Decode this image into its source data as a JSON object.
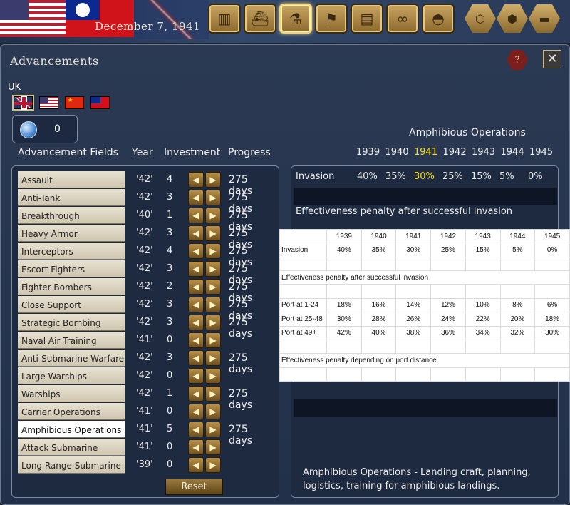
{
  "topbar": {
    "date": "December 7, 1941",
    "icons": [
      "factory-icon",
      "ship-icon",
      "microscope-icon",
      "flag-icon",
      "clipboard-icon",
      "binoculars-icon",
      "helmet-icon",
      "hex-icon",
      "hexes-icon",
      "tank-icon"
    ]
  },
  "panel": {
    "title": "Advancements",
    "help_label": "?",
    "close_label": "✕"
  },
  "country": {
    "name": "UK",
    "flags": [
      "uk",
      "us",
      "china",
      "roc"
    ]
  },
  "points": {
    "value": "0"
  },
  "columns": {
    "field": "Advancement Fields",
    "year": "Year",
    "investment": "Investment",
    "progress": "Progress"
  },
  "fields": [
    {
      "name": "Assault",
      "year": "'42'",
      "inv": "4",
      "progress": "275 days"
    },
    {
      "name": "Anti-Tank",
      "year": "'42'",
      "inv": "3",
      "progress": "275 days"
    },
    {
      "name": "Breakthrough",
      "year": "'40'",
      "inv": "1",
      "progress": "275 days"
    },
    {
      "name": "Heavy Armor",
      "year": "'42'",
      "inv": "3",
      "progress": "275 days"
    },
    {
      "name": "Interceptors",
      "year": "'42'",
      "inv": "4",
      "progress": "275 days"
    },
    {
      "name": "Escort Fighters",
      "year": "'42'",
      "inv": "3",
      "progress": "275 days"
    },
    {
      "name": "Fighter Bombers",
      "year": "'42'",
      "inv": "2",
      "progress": "275 days"
    },
    {
      "name": "Close Support",
      "year": "'42'",
      "inv": "3",
      "progress": "275 days"
    },
    {
      "name": "Strategic Bombing",
      "year": "'42'",
      "inv": "3",
      "progress": "275 days"
    },
    {
      "name": "Naval Air Training",
      "year": "'41'",
      "inv": "0",
      "progress": ""
    },
    {
      "name": "Anti-Submarine Warfare",
      "year": "'42'",
      "inv": "3",
      "progress": "275 days"
    },
    {
      "name": "Large Warships",
      "year": "'42'",
      "inv": "0",
      "progress": ""
    },
    {
      "name": "Warships",
      "year": "'42'",
      "inv": "1",
      "progress": "275 days"
    },
    {
      "name": "Carrier Operations",
      "year": "'41'",
      "inv": "0",
      "progress": ""
    },
    {
      "name": "Amphibious Operations",
      "year": "'41'",
      "inv": "5",
      "progress": "275 days",
      "selected": true
    },
    {
      "name": "Attack Submarine",
      "year": "'41'",
      "inv": "0",
      "progress": ""
    },
    {
      "name": "Long Range Submarine",
      "year": "'39'",
      "inv": "0",
      "progress": ""
    }
  ],
  "reset_label": "Reset",
  "detail": {
    "title": "Amphibious Operations",
    "years": [
      "1939",
      "1940",
      "1941",
      "1942",
      "1943",
      "1944",
      "1945"
    ],
    "current_year": "1941",
    "invasion_label": "Invasion",
    "invasion_values": [
      "40%",
      "35%",
      "30%",
      "25%",
      "15%",
      "5%",
      "0%"
    ],
    "effectiveness_title": "Effectiveness penalty after successful invasion",
    "description": "Amphibious Operations - Landing craft, planning, logistics, training for amphibious landings."
  },
  "overlay_table": {
    "years": [
      "1939",
      "1940",
      "1941",
      "1942",
      "1943",
      "1944",
      "1945"
    ],
    "invasion_label": "Invasion",
    "invasion": [
      "40%",
      "35%",
      "30%",
      "25%",
      "15%",
      "5%",
      "0%"
    ],
    "eff_after_invasion": "Effectiveness penalty after successful invasion",
    "ports": [
      {
        "label": "Port at 1-24",
        "values": [
          "18%",
          "16%",
          "14%",
          "12%",
          "10%",
          "8%",
          "6%"
        ]
      },
      {
        "label": "Port at 25-48",
        "values": [
          "30%",
          "28%",
          "26%",
          "24%",
          "22%",
          "20%",
          "18%"
        ]
      },
      {
        "label": "Port at 49+",
        "values": [
          "42%",
          "40%",
          "38%",
          "36%",
          "34%",
          "32%",
          "30%"
        ]
      }
    ],
    "eff_port_distance": "Effectiveness penalty depending on port distance"
  }
}
